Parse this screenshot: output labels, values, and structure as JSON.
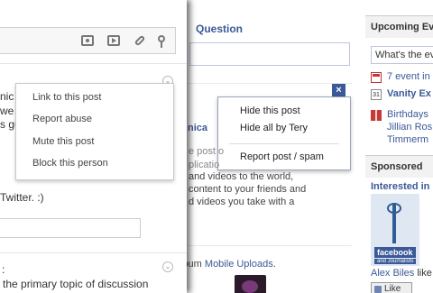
{
  "facebook": {
    "question_link": "Question",
    "partial_heading": "nica",
    "grey_lines": [
      "e post o",
      "plicatio"
    ],
    "body_lines": [
      "and videos to the world,",
      "content to your friends and",
      "d videos you take with a"
    ],
    "album_prefix": "lbum ",
    "album_link": "Mobile Uploads",
    "album_suffix": ".",
    "hide_menu": {
      "close_label": "×",
      "items": [
        "Hide this post",
        "Hide all by Tery",
        "Report post / spam"
      ]
    },
    "sidebar": {
      "upcoming_header": "Upcoming Ev",
      "whats_input": "What's the ev",
      "event_link": "7 event in",
      "vanity_link": "Vanity Ex",
      "cal_number": "31",
      "birthdays": [
        "Birthdays",
        "Jillian Ros",
        "Timmerm"
      ],
      "sponsored_header": "Sponsored",
      "interested": "Interested in",
      "ad_word": "facebook",
      "ad_sub": "and Journalists",
      "alex_name": "Alex Biles",
      "alex_suffix": " like",
      "like_label": "Like"
    },
    "colors": {
      "brand": "#3b5998",
      "menu_border": "#9aa4b8"
    }
  },
  "googleplus": {
    "peek_lines": [
      "nic",
      "we",
      "s gu"
    ],
    "twitter_line": "Twitter. :)",
    "topic_line": "the primary topic of discussion",
    "chev_glyph": "⌄",
    "post_menu": {
      "items": [
        "Link to this post",
        "Report abuse",
        "Mute this post",
        "Block this person"
      ]
    },
    "icons": [
      "camera-icon",
      "video-icon",
      "link-icon",
      "location-pin-icon"
    ]
  }
}
